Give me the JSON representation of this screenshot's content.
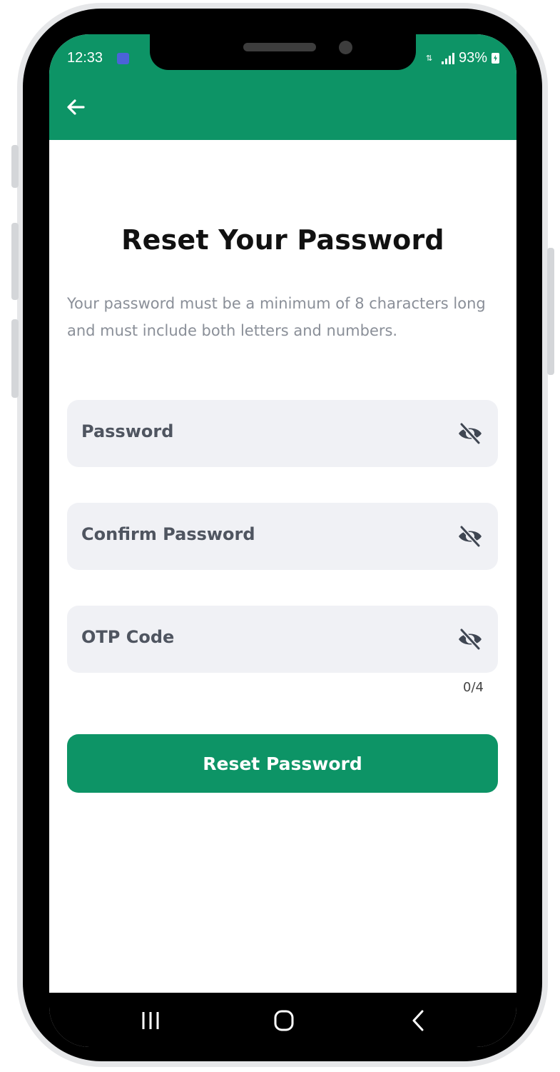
{
  "status_bar": {
    "time": "12:33",
    "battery": "93%",
    "icons": [
      "notification-square-icon",
      "data-transfer-icon",
      "signal-icon",
      "battery-charging-icon"
    ]
  },
  "app_bar": {
    "back_icon": "back-arrow-icon"
  },
  "page": {
    "title": "Reset Your Password",
    "description": "Your password must be a minimum of 8 characters long and must include both letters and numbers."
  },
  "fields": {
    "password": {
      "placeholder": "Password",
      "value": "",
      "icon": "eye-off-icon"
    },
    "confirm_password": {
      "placeholder": "Confirm Password",
      "value": "",
      "icon": "eye-off-icon"
    },
    "otp": {
      "placeholder": "OTP Code",
      "value": "",
      "icon": "eye-off-icon",
      "counter": "0/4"
    }
  },
  "actions": {
    "reset_label": "Reset Password"
  },
  "nav_bar": {
    "items": [
      "recent-apps-icon",
      "home-icon",
      "back-icon"
    ]
  },
  "colors": {
    "primary": "#0d9466",
    "field_bg": "#f0f1f5",
    "text_dark": "#111111",
    "text_muted": "#8a8f98"
  }
}
